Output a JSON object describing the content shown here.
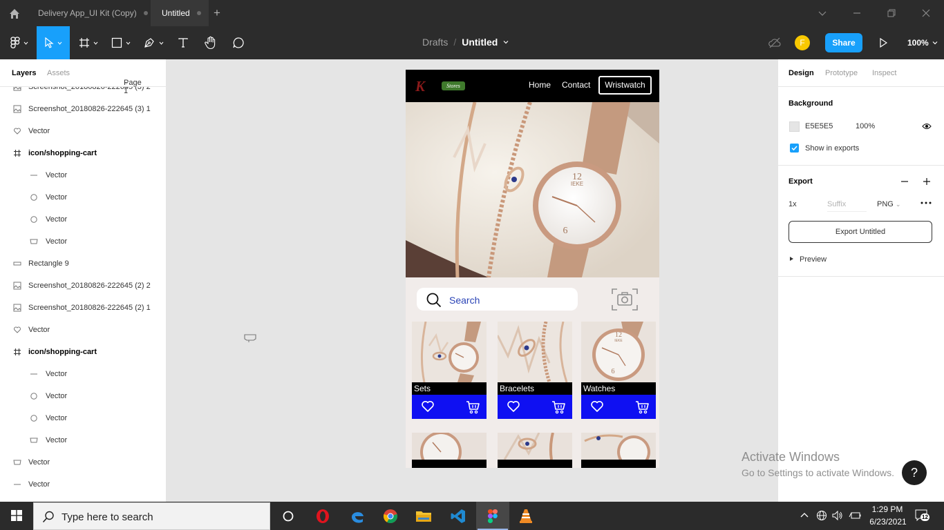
{
  "titlebar": {
    "tabs": [
      {
        "label": "Delivery App_UI Kit (Copy)"
      },
      {
        "label": "Untitled"
      }
    ],
    "new_tab": "+"
  },
  "toolbar": {
    "breadcrumb_root": "Drafts",
    "breadcrumb_sep": "/",
    "file_name": "Untitled",
    "avatar_initial": "F",
    "share_label": "Share",
    "zoom": "100%"
  },
  "left_panel": {
    "tab_layers": "Layers",
    "tab_assets": "Assets",
    "page": "Page 1",
    "layers": [
      {
        "label": "Screenshot_20180826-222645 (3) 2",
        "icon": "image-icon",
        "indent": 0,
        "bold": false
      },
      {
        "label": "Screenshot_20180826-222645 (3) 1",
        "icon": "image-icon",
        "indent": 0,
        "bold": false
      },
      {
        "label": "Vector",
        "icon": "heart-vector-icon",
        "indent": 0,
        "bold": false
      },
      {
        "label": "icon/shopping-cart",
        "icon": "frame-icon",
        "indent": 0,
        "bold": true
      },
      {
        "label": "Vector",
        "icon": "line-vector-icon",
        "indent": 1,
        "bold": false
      },
      {
        "label": "Vector",
        "icon": "circle-vector-icon",
        "indent": 1,
        "bold": false
      },
      {
        "label": "Vector",
        "icon": "circle-vector-icon",
        "indent": 1,
        "bold": false
      },
      {
        "label": "Vector",
        "icon": "cart-vector-icon",
        "indent": 1,
        "bold": false
      },
      {
        "label": "Rectangle 9",
        "icon": "rectangle-icon",
        "indent": 0,
        "bold": false
      },
      {
        "label": "Screenshot_20180826-222645 (2) 2",
        "icon": "image-icon",
        "indent": 0,
        "bold": false
      },
      {
        "label": "Screenshot_20180826-222645 (2) 1",
        "icon": "image-icon",
        "indent": 0,
        "bold": false
      },
      {
        "label": "Vector",
        "icon": "heart-vector-icon",
        "indent": 0,
        "bold": false
      },
      {
        "label": "icon/shopping-cart",
        "icon": "frame-icon",
        "indent": 0,
        "bold": true
      },
      {
        "label": "Vector",
        "icon": "line-vector-icon",
        "indent": 1,
        "bold": false
      },
      {
        "label": "Vector",
        "icon": "circle-vector-icon",
        "indent": 1,
        "bold": false
      },
      {
        "label": "Vector",
        "icon": "circle-vector-icon",
        "indent": 1,
        "bold": false
      },
      {
        "label": "Vector",
        "icon": "cart-vector-icon",
        "indent": 1,
        "bold": false
      },
      {
        "label": "Vector",
        "icon": "cart-vector-icon",
        "indent": 0,
        "bold": false
      },
      {
        "label": "Vector",
        "icon": "line-vector-icon",
        "indent": 0,
        "bold": false
      }
    ]
  },
  "design": {
    "nav": {
      "logo": "K",
      "logo_badge": "Stores",
      "home": "Home",
      "contact": "Contact",
      "wristwatch": "Wristwatch"
    },
    "search_placeholder": "Search",
    "categories": [
      {
        "label": "Sets"
      },
      {
        "label": "Bracelets"
      },
      {
        "label": "Watches"
      }
    ],
    "watch_brand": "IEKE",
    "watch_num_12": "12",
    "watch_num_6": "6"
  },
  "right_panel": {
    "tab_design": "Design",
    "tab_prototype": "Prototype",
    "tab_inspect": "Inspect",
    "background_title": "Background",
    "background_hex": "E5E5E5",
    "background_opacity": "100%",
    "show_in_exports": "Show in exports",
    "export_title": "Export",
    "export_scale": "1x",
    "export_suffix_placeholder": "Suffix",
    "export_format": "PNG",
    "export_button": "Export Untitled",
    "preview": "Preview"
  },
  "watermark": {
    "line1": "Activate Windows",
    "line2": "Go to Settings to activate Windows."
  },
  "help": "?",
  "taskbar": {
    "search_placeholder": "Type here to search",
    "time": "1:29 PM",
    "date": "6/23/2021",
    "notifications": "12"
  },
  "colors": {
    "figma_blue": "#18a0fb",
    "card_blue": "#0f10f2",
    "search_blue": "#2a43b6",
    "canvas_bg": "#e5e5e5"
  }
}
